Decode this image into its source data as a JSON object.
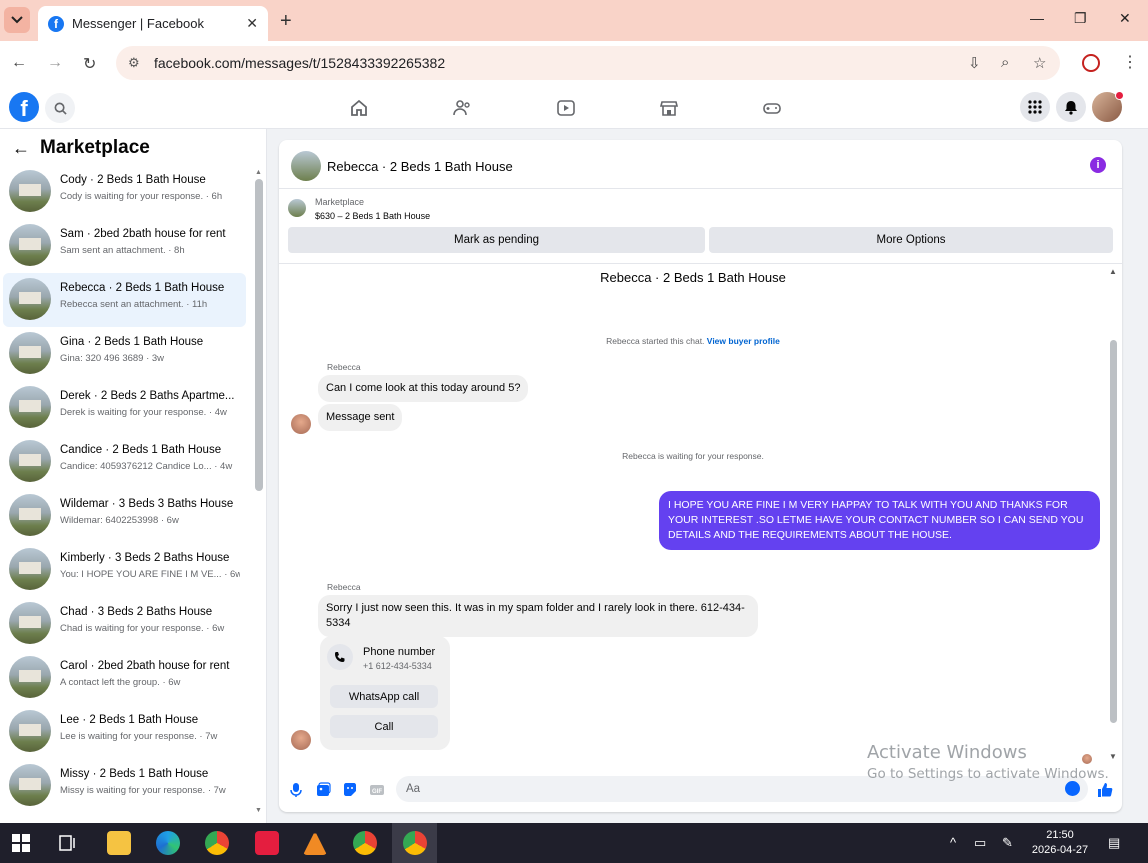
{
  "browser": {
    "tab_title": "Messenger | Facebook",
    "url": "facebook.com/messages/t/1528433392265382",
    "new_tab": "+",
    "tab_close": "✕"
  },
  "fb": {
    "logo": "f"
  },
  "sidebar": {
    "title": "Marketplace",
    "conversations": [
      {
        "name": "Cody · 2 Beds 1 Bath House",
        "sub": "Cody is waiting for your response. · 6h"
      },
      {
        "name": "Sam · 2bed 2bath house for rent",
        "sub": "Sam sent an attachment. · 8h"
      },
      {
        "name": "Rebecca · 2 Beds 1 Bath House",
        "sub": "Rebecca sent an attachment. · 11h"
      },
      {
        "name": "Gina · 2 Beds 1 Bath House",
        "sub": "Gina: 320 496 3689 · 3w"
      },
      {
        "name": "Derek · 2 Beds 2 Baths Apartme...",
        "sub": "Derek is waiting for your response. · 4w"
      },
      {
        "name": "Candice · 2 Beds 1 Bath House",
        "sub": "Candice: 4059376212 Candice Lo... · 4w"
      },
      {
        "name": "Wildemar · 3 Beds 3 Baths House",
        "sub": "Wildemar: 6402253998 · 6w"
      },
      {
        "name": "Kimberly · 3 Beds 2 Baths House",
        "sub": "You: I HOPE YOU ARE FINE I M VE... · 6w"
      },
      {
        "name": "Chad · 3 Beds 2 Baths House",
        "sub": "Chad is waiting for your response. · 6w"
      },
      {
        "name": "Carol · 2bed 2bath house for rent",
        "sub": "A contact left the group. · 6w"
      },
      {
        "name": "Lee · 2 Beds 1 Bath House",
        "sub": "Lee is waiting for your response. · 7w"
      },
      {
        "name": "Missy · 2 Beds 1 Bath House",
        "sub": "Missy is waiting for your response. · 7w"
      }
    ]
  },
  "chat": {
    "header_title": "Rebecca · 2 Beds 1 Bath House",
    "info_icon": "i",
    "marketplace_label": "Marketplace",
    "listing": "$630 – 2 Beds 1 Bath House",
    "mark_pending": "Mark as pending",
    "more_options": "More Options",
    "conversation_title": "Rebecca · 2 Beds 1 Bath House",
    "started_text": "Rebecca started this chat.",
    "view_profile": "View buyer profile",
    "sender_1": "Rebecca",
    "msg_1": "Can I come look at this today around 5?",
    "msg_2": "Message sent",
    "waiting_text": "Rebecca is waiting for your response.",
    "my_msg": "I HOPE YOU ARE FINE I M VERY HAPPAY TO TALK WITH YOU AND THANKS FOR YOUR INTEREST .SO LETME HAVE YOUR CONTACT NUMBER SO I CAN SEND YOU DETAILS AND THE REQUIREMENTS ABOUT THE HOUSE.",
    "sender_2": "Rebecca",
    "msg_3": "Sorry I just now seen this. It was in my spam folder and I rarely look in there.  612-434-5334",
    "phone_label": "Phone number",
    "phone_value": "+1 612-434-5334",
    "whatsapp_call": "WhatsApp call",
    "call": "Call",
    "composer_placeholder": "Aa"
  },
  "watermark": {
    "line1": "Activate Windows",
    "line2": "Go to Settings to activate Windows."
  },
  "taskbar": {
    "time": "21:50",
    "date": "2026-04-27"
  }
}
